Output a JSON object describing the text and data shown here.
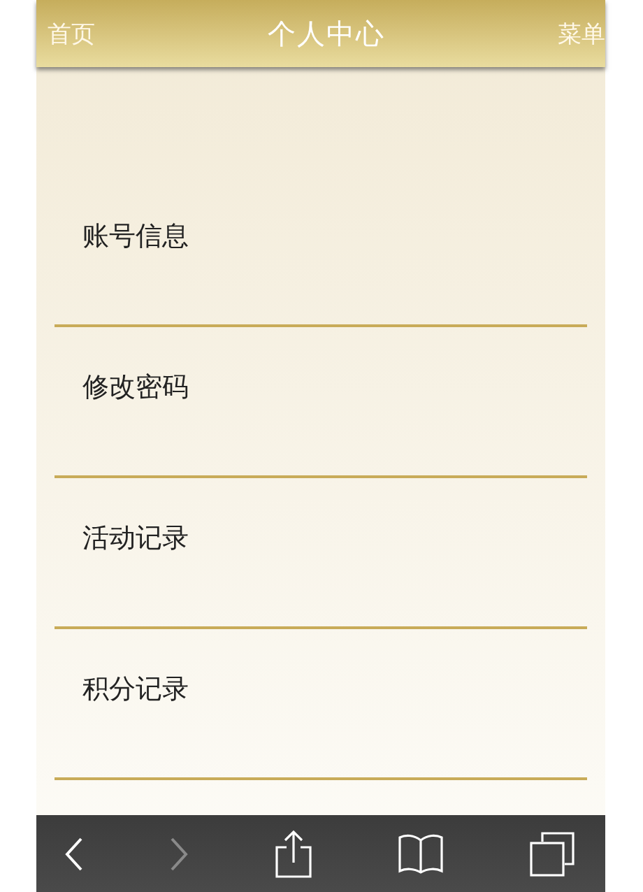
{
  "header": {
    "left": "首页",
    "title": "个人中心",
    "right": "菜单"
  },
  "menu_items": [
    {
      "label": "账号信息"
    },
    {
      "label": "修改密码"
    },
    {
      "label": "活动记录"
    },
    {
      "label": "积分记录"
    }
  ],
  "toolbar": [
    {
      "kind": "back",
      "disabled": false
    },
    {
      "kind": "forward",
      "disabled": true
    },
    {
      "kind": "share",
      "disabled": false
    },
    {
      "kind": "bookmarks",
      "disabled": false
    },
    {
      "kind": "tabs",
      "disabled": false
    }
  ]
}
